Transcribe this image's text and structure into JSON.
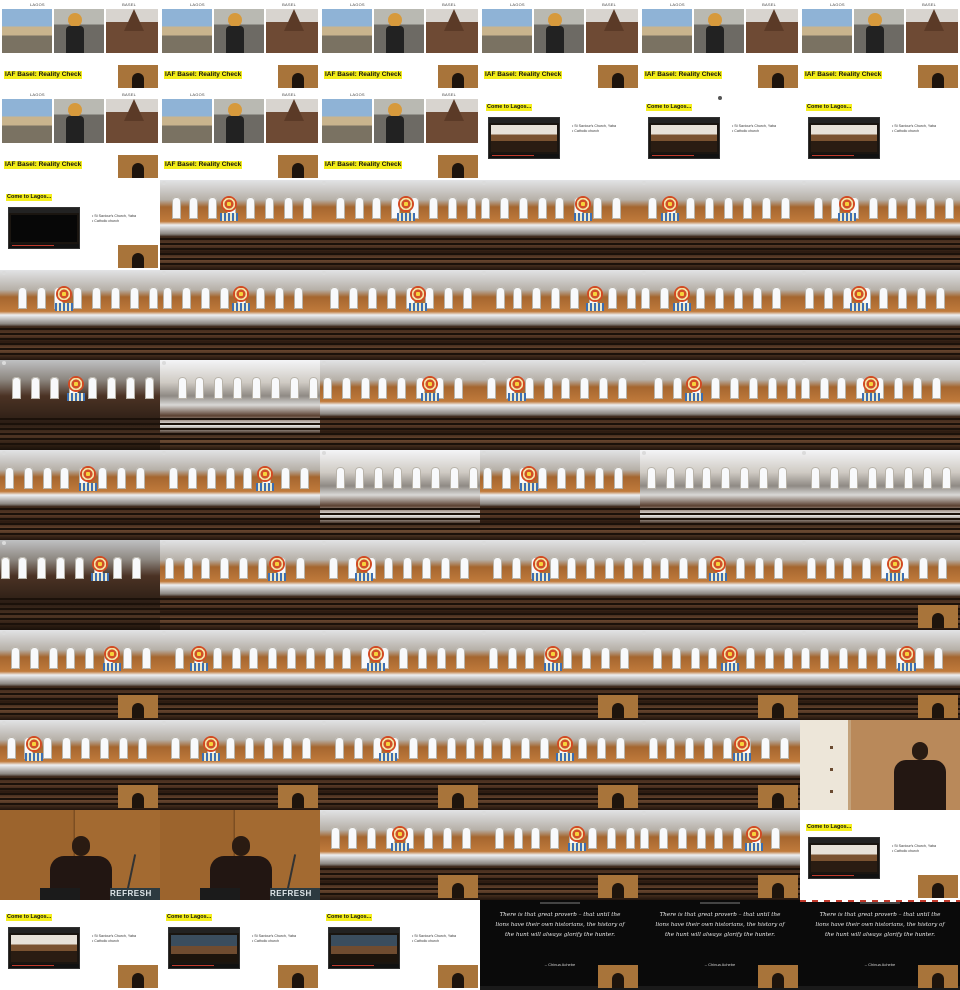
{
  "basel": {
    "title": "IAF Basel: Reality Check",
    "label_left": "LAGOS",
    "label_right": "BASEL"
  },
  "lagos": {
    "title": "Come to Lagos...",
    "bullet_1": "St Saviour's Church, Yaba",
    "bullet_2": "Catholic church"
  },
  "quote": {
    "text": "There is that great proverb – that until the lions have their own historians, the history of the hunt will always glorify the hunter.",
    "author": "– Chinua Achebe"
  },
  "speaker": {
    "banner": "REFRESH"
  },
  "tiles": [
    "basel",
    "basel",
    "basel",
    "basel",
    "basel",
    "basel",
    "basel",
    "basel",
    "basel",
    "lagos",
    "lagos-dot",
    "lagos",
    "lagos-black",
    "pano",
    "pano",
    "pano",
    "pano",
    "pano",
    "pano",
    "pano",
    "pano",
    "pano",
    "pano",
    "pano",
    "pano-dark",
    "pano-bright",
    "pano",
    "pano",
    "pano",
    "pano",
    "pano",
    "pano",
    "pano-bright",
    "pano",
    "pano-bright",
    "pano-bright",
    "pano-dark",
    "pano",
    "pano",
    "pano",
    "pano",
    "pano-cam",
    "pano-cam",
    "pano",
    "pano",
    "pano-cam",
    "pano-cam",
    "pano-cam",
    "pano-cam",
    "pano-cam",
    "pano-cam",
    "pano-cam",
    "pano-cam",
    "speaker-close",
    "speaker-wide",
    "speaker-wide",
    "pano-cam",
    "pano-cam",
    "pano-cam",
    "lagos-cam",
    "lagos-cam",
    "lagos-people",
    "lagos-people",
    "quote",
    "quote",
    "quote-strip"
  ]
}
